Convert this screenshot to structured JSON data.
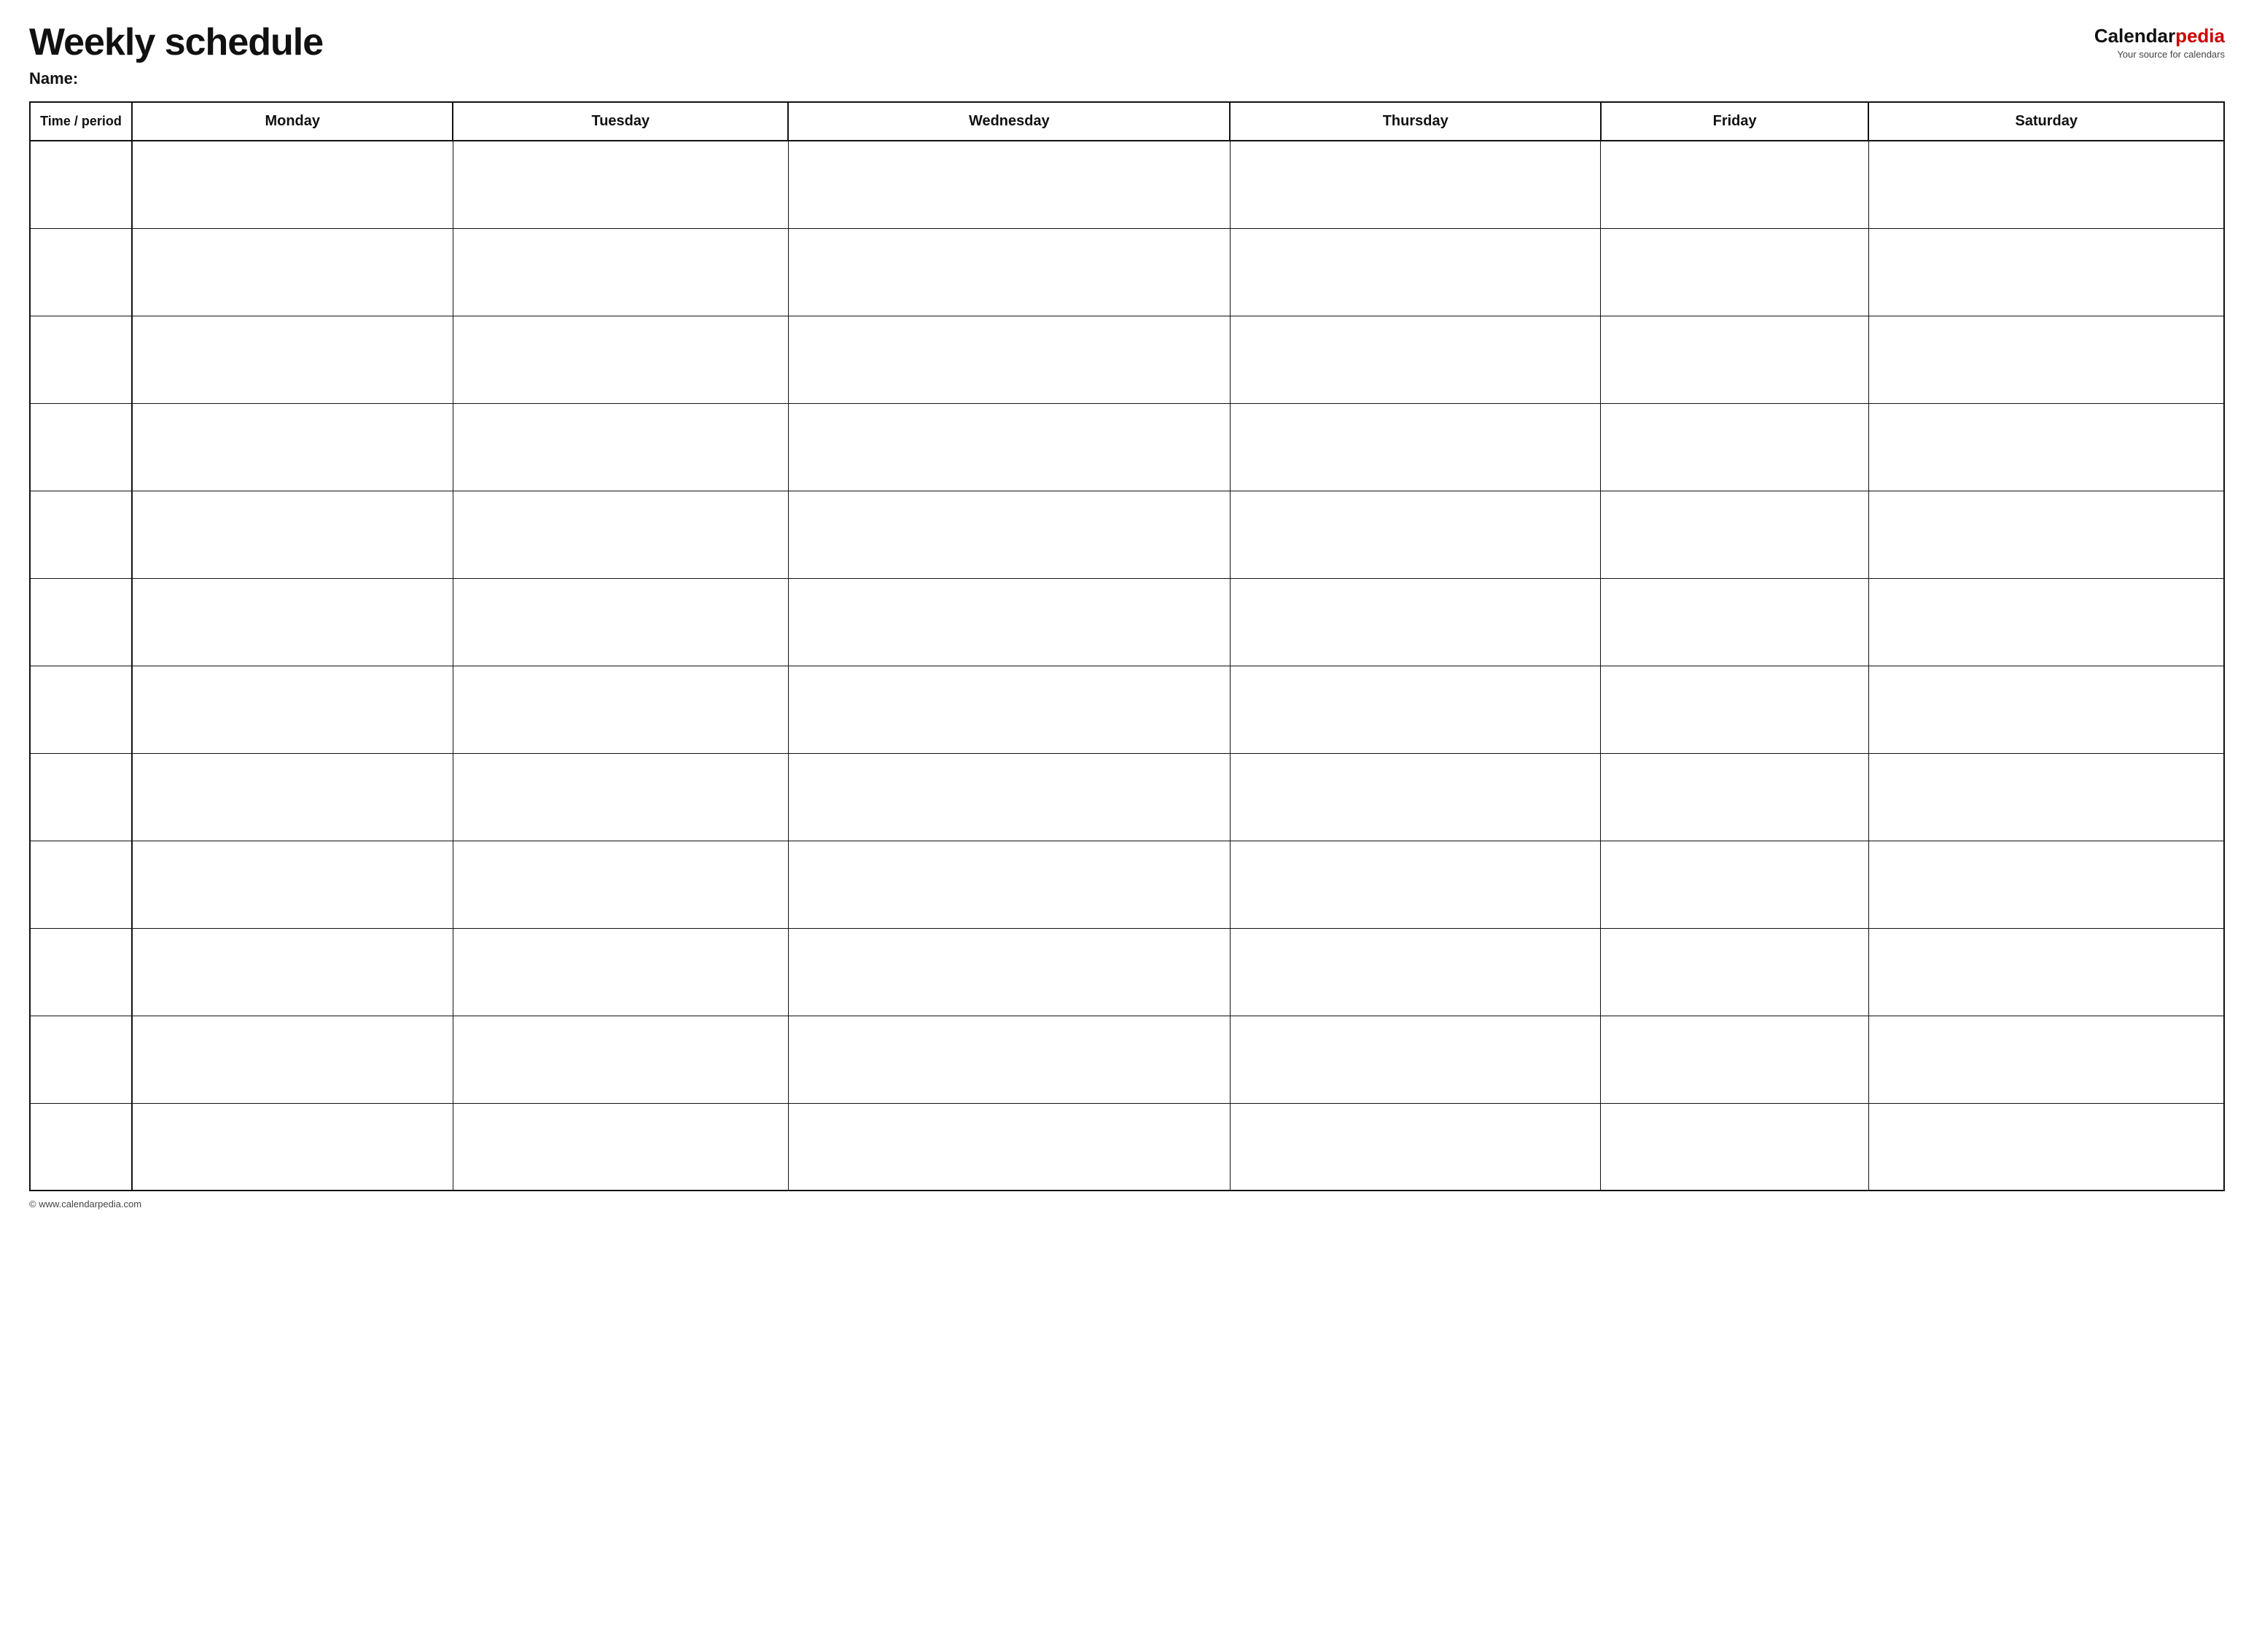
{
  "header": {
    "title": "Weekly schedule",
    "name_label": "Name:",
    "logo_main": "Calendar",
    "logo_accent": "pedia",
    "logo_subtitle": "Your source for calendars"
  },
  "table": {
    "columns": [
      {
        "id": "time",
        "label": "Time / period"
      },
      {
        "id": "monday",
        "label": "Monday"
      },
      {
        "id": "tuesday",
        "label": "Tuesday"
      },
      {
        "id": "wednesday",
        "label": "Wednesday"
      },
      {
        "id": "thursday",
        "label": "Thursday"
      },
      {
        "id": "friday",
        "label": "Friday"
      },
      {
        "id": "saturday",
        "label": "Saturday"
      }
    ],
    "row_count": 12
  },
  "footer": {
    "url": "© www.calendarpedia.com"
  }
}
